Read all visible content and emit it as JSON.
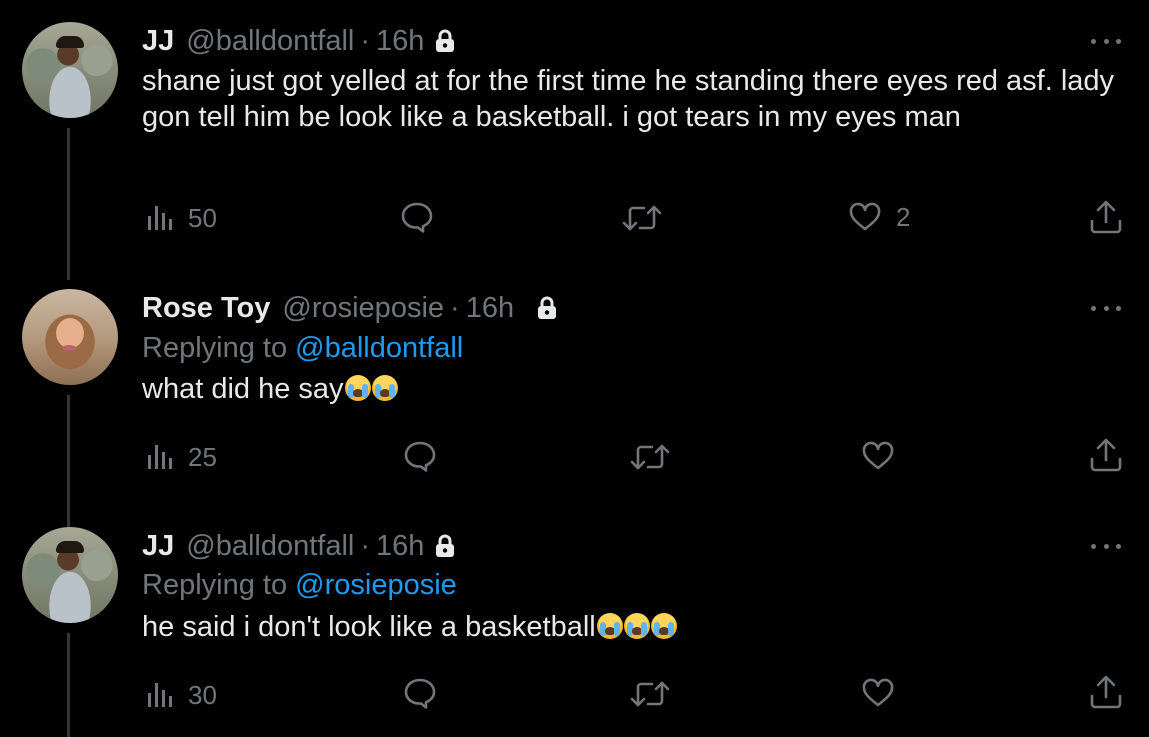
{
  "tweets": [
    {
      "name": "JJ",
      "handle": "@balldontfall",
      "separator": "·",
      "time": "16h",
      "replying_prefix": "",
      "replying_to": "",
      "text": "shane just got yelled at for the first time he standing there eyes red asf. lady gon tell him be look like a basketball. i got tears in my eyes man",
      "emojis": 0,
      "views": "50",
      "replies": "",
      "retweets": "",
      "likes": "2"
    },
    {
      "name": "Rose Toy",
      "handle": "@rosieposie",
      "separator": "·",
      "time": "16h",
      "replying_prefix": "Replying to",
      "replying_to": "@balldontfall",
      "text": "what did he say",
      "emojis": 2,
      "views": "25",
      "replies": "",
      "retweets": "",
      "likes": ""
    },
    {
      "name": "JJ",
      "handle": "@balldontfall",
      "separator": "·",
      "time": "16h",
      "replying_prefix": "Replying to",
      "replying_to": "@rosieposie",
      "text": "he said i don't look like a basketball",
      "emojis": 3,
      "views": "30",
      "replies": "",
      "retweets": "",
      "likes": ""
    }
  ],
  "icons": {
    "lock": "lock-icon",
    "more": "more-icon",
    "views": "analytics-icon",
    "reply": "reply-icon",
    "retweet": "retweet-icon",
    "like": "heart-icon",
    "share": "share-icon",
    "emoji": "loudly-crying-face-emoji"
  },
  "colors": {
    "background": "#000000",
    "text": "#e7e9ea",
    "secondary": "#71767b",
    "link": "#1d9bf0",
    "thread_line": "#333639"
  }
}
